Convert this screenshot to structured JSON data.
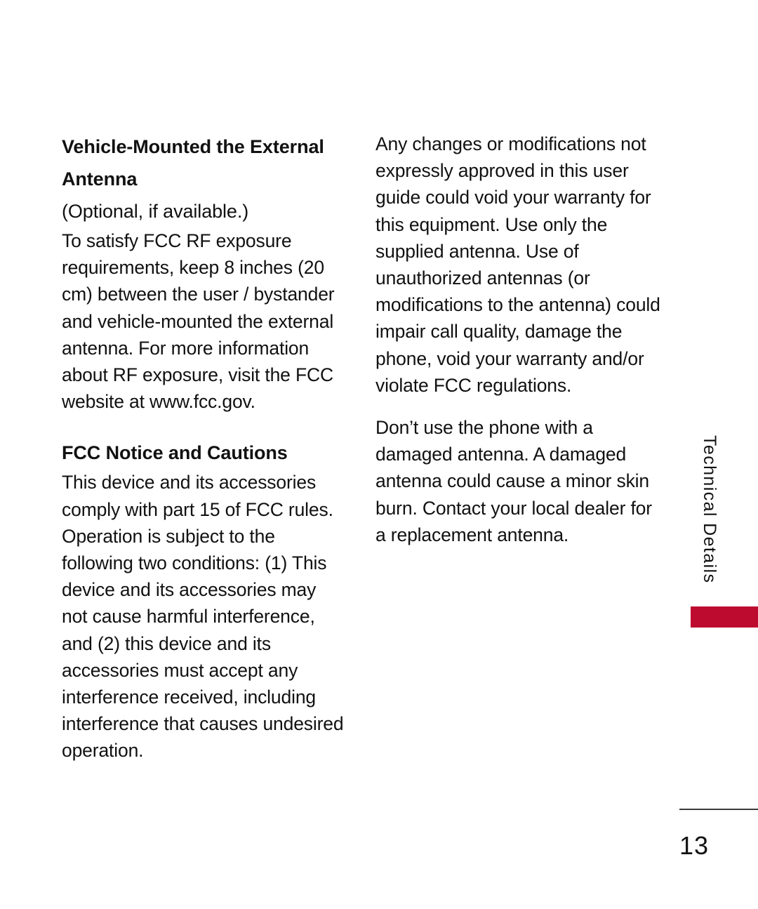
{
  "page": {
    "number": "13",
    "background_color": "#ffffff",
    "text_color": "#111111"
  },
  "side_tab": {
    "label": "Technical Details",
    "accent_color": "#BD0A2F"
  },
  "left_column": {
    "heading": "Vehicle-Mounted the External Antenna",
    "subheading": "(Optional, if available.)",
    "paragraph_1": "To satisfy FCC RF exposure requirements, keep 8 inches (20 cm) between the user / bystander and vehicle-mounted the external antenna. For more information about RF exposure, visit the FCC website at www.fcc.gov.",
    "section_heading": "FCC Notice and Cautions",
    "paragraph_2": "This device and its accessories comply with part 15 of FCC rules. Operation is subject to the following two conditions: (1) This device and its accessories may not cause harmful interference, and (2) this device and its accessories must accept any interference received, including interference that causes undesired operation."
  },
  "right_column": {
    "paragraph_1": "Any changes or modifications not expressly approved in this user guide could void your warranty for this equipment.  Use only the supplied antenna. Use of unauthorized antennas (or modifications to the antenna) could impair call quality, damage the phone, void your warranty and/or violate FCC regulations.",
    "paragraph_2": "Don’t use the phone with a damaged antenna. A damaged antenna could cause a minor skin burn. Contact your local dealer for a replacement antenna."
  }
}
